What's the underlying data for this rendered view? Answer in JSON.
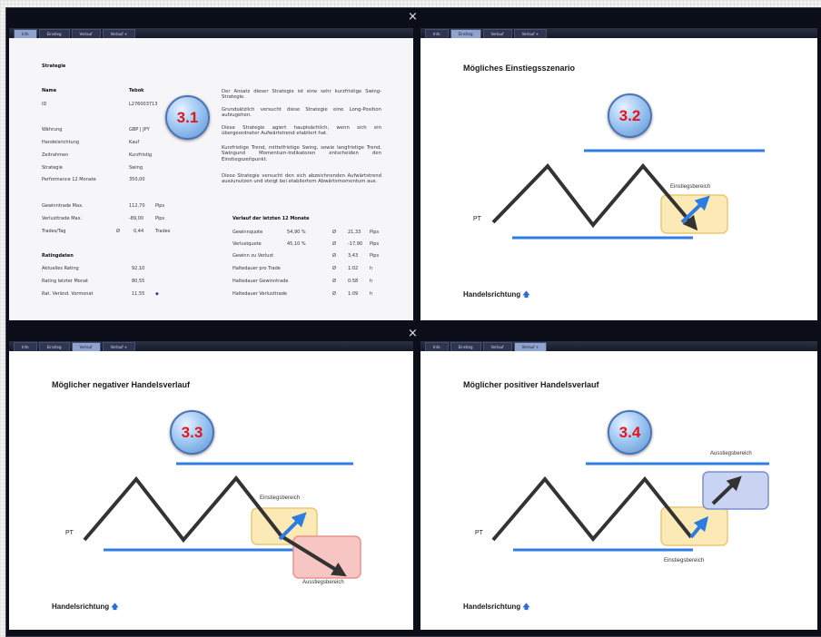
{
  "colors": {
    "frame": "#0b0e18",
    "line_blue": "#2f7de0",
    "arrow_dark": "#333333",
    "arrow_blue": "#2d7ce0",
    "zone_yellow": "#fbe9b6",
    "zone_red": "#f7c6c2",
    "zone_blue": "#c9d3f2",
    "badge_text": "#e3151a"
  },
  "icons": {
    "close": "close-x-icon",
    "direction": "arrow-up-icon"
  },
  "close_glyph": "×",
  "panels": {
    "p1": {
      "tabs": [
        "Info",
        "Einstieg",
        "Verlauf",
        "Verlauf +"
      ],
      "badge": "3.1",
      "title": "Strategie",
      "header_name": "Name",
      "header_value": "Tebok",
      "rows": [
        {
          "label": "ID",
          "value": "L276003713"
        },
        {
          "label": "Währung",
          "value": "GBP | JPY"
        },
        {
          "label": "Handelsrichtung",
          "value": "Kauf"
        },
        {
          "label": "Zeitrahmen",
          "value": "Kurzfristig"
        },
        {
          "label": "Strategie",
          "value": "Swing"
        },
        {
          "label": "Performance 12 Monate",
          "value": "350,00"
        }
      ],
      "trades": [
        {
          "label": "Gewinntrade Max.",
          "value": "112,70",
          "unit": "Pips"
        },
        {
          "label": "Verlusttrade Max.",
          "value": "-89,00",
          "unit": "Pips"
        },
        {
          "label": "Trades/Tag",
          "avg": "Ø",
          "value": "0,44",
          "unit": "Trades"
        }
      ],
      "ratings_title": "Ratingdaten",
      "ratings": [
        {
          "label": "Aktuelles Rating",
          "value": "92,10"
        },
        {
          "label": "Rating letzter Monat",
          "value": "80,55"
        },
        {
          "label": "Rat. Veränd. Vormonat",
          "value": "11,55",
          "icon": "◆"
        }
      ],
      "paragraphs": [
        "Der Ansatz dieser Strategie ist eine sehr kurzfristige Swing-Strategie.",
        "Grundsätzlich versucht diese Strategie eine Long-Position aufzugehen.",
        "Diese Strategie agiert hauptsächlich, wenn sich ein übergeordneter Aufwärtstrend etabliert hat.",
        "Kurzfristige Trend, mittelfristige Swing, sowie langfristige Trend, Swingund Momentum-Indikatoren entscheiden den Einstiegszeitpunkt.",
        "Diese Strategie versucht den sich abzeichnenden Aufwärtstrend auszunutzen und steigt bei etabliertem Abwärtsmomentum aus."
      ],
      "history_title": "Verlauf der letzten 12 Monate",
      "history": [
        {
          "label": "Gewinnquote",
          "pct": "54,90 %",
          "avg": "Ø",
          "value": "21,33",
          "unit": "Pips"
        },
        {
          "label": "Verlustquote",
          "pct": "45,10 %",
          "avg": "Ø",
          "value": "-17,90",
          "unit": "Pips"
        },
        {
          "label": "Gewinn zu Verlust",
          "pct": "",
          "avg": "Ø",
          "value": "3,43",
          "unit": "Pips"
        },
        {
          "label": "Haltedauer pro Trade",
          "pct": "",
          "avg": "Ø",
          "value": "1:02",
          "unit": "h"
        },
        {
          "label": "Haltedauer Gewinntrade",
          "pct": "",
          "avg": "Ø",
          "value": "0:58",
          "unit": "h"
        },
        {
          "label": "Haltedauer Verlusttrade",
          "pct": "",
          "avg": "Ø",
          "value": "1:09",
          "unit": "h"
        }
      ]
    },
    "p2": {
      "tabs": [
        "Info",
        "Einstieg",
        "Verlauf",
        "Verlauf +"
      ],
      "badge": "3.2",
      "title": "Mögliches Einstiegsszenario",
      "pt": "PT",
      "entry_label": "Einstiegsbereich",
      "direction_label": "Handelsrichtung",
      "direction_icon": "🡅"
    },
    "p3": {
      "tabs": [
        "Info",
        "Einstieg",
        "Verlauf",
        "Verlauf +"
      ],
      "badge": "3.3",
      "title": "Möglicher negativer Handelsverlauf",
      "pt": "PT",
      "entry_label": "Einstiegsbereich",
      "exit_label": "Ausstiegsbereich",
      "direction_label": "Handelsrichtung",
      "direction_icon": "🡅"
    },
    "p4": {
      "tabs": [
        "Info",
        "Einstieg",
        "Verlauf",
        "Verlauf +"
      ],
      "badge": "3.4",
      "title": "Möglicher positiver Handelsverlauf",
      "pt": "PT",
      "entry_label": "Einstiegsbereich",
      "exit_label": "Ausstiegsbereich",
      "direction_label": "Handelsrichtung",
      "direction_icon": "🡅"
    }
  }
}
